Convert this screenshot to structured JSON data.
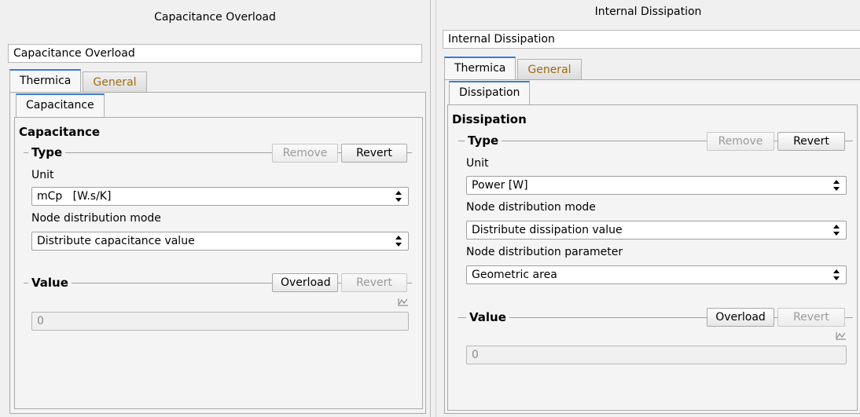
{
  "left": {
    "title": "Capacitance Overload",
    "name_value": "Capacitance Overload",
    "tabs": [
      {
        "label": "Thermica",
        "active": true
      },
      {
        "label": "General",
        "active": false
      }
    ],
    "subtab": "Capacitance",
    "section_title": "Capacitance",
    "type_group": {
      "label": "Type",
      "remove_label": "Remove",
      "revert_label": "Revert"
    },
    "unit_label": "Unit",
    "unit_value": "mCp   [W.s/K]",
    "mode_label": "Node distribution mode",
    "mode_value": "Distribute capacitance value",
    "value_group": {
      "label": "Value",
      "overload_label": "Overload",
      "revert_label": "Revert"
    },
    "value": "0"
  },
  "right": {
    "title": "Internal Dissipation",
    "name_value": "Internal Dissipation",
    "tabs": [
      {
        "label": "Thermica",
        "active": true
      },
      {
        "label": "General",
        "active": false
      }
    ],
    "subtab": "Dissipation",
    "section_title": "Dissipation",
    "type_group": {
      "label": "Type",
      "remove_label": "Remove",
      "revert_label": "Revert"
    },
    "unit_label": "Unit",
    "unit_value": "Power [W]",
    "mode_label": "Node distribution mode",
    "mode_value": "Distribute dissipation value",
    "param_label": "Node distribution parameter",
    "param_value": "Geometric area",
    "value_group": {
      "label": "Value",
      "overload_label": "Overload",
      "revert_label": "Revert"
    },
    "value": "0"
  },
  "icons": {
    "combo_arrow": "updown-arrows-icon",
    "graph": "graph-icon"
  },
  "colors": {
    "active_tab_accent": "#3a7bd5",
    "inactive_tab_text": "#a06b10"
  }
}
